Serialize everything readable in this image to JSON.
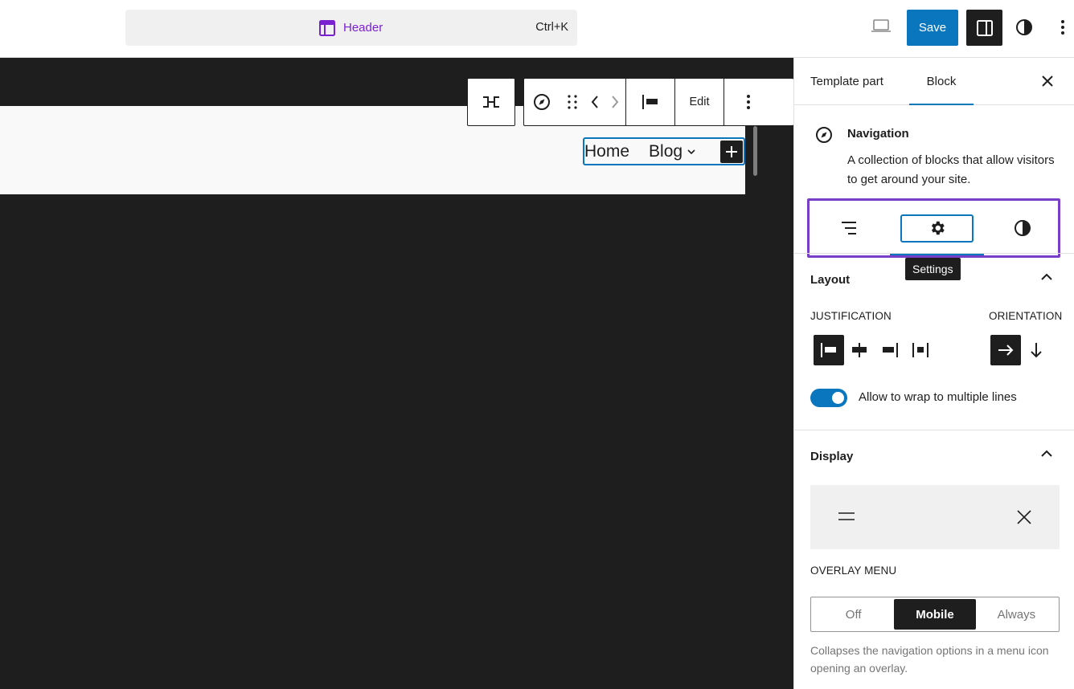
{
  "header": {
    "command_title": "Header",
    "command_shortcut": "Ctrl+K",
    "save_label": "Save",
    "accent_color": "#0a76bd",
    "template_color": "#7b1fd3"
  },
  "canvas": {
    "nav_items": [
      "Home",
      "Blog"
    ],
    "toolbar_edit_label": "Edit"
  },
  "sidebar": {
    "tabs": [
      "Template part",
      "Block"
    ],
    "block": {
      "title": "Navigation",
      "description": "A collection of blocks that allow visitors to get around your site."
    },
    "tooltip": "Settings",
    "layout": {
      "title": "Layout",
      "justification_label": "JUSTIFICATION",
      "orientation_label": "ORIENTATION",
      "wrap_label": "Allow to wrap to multiple lines",
      "wrap_enabled": true
    },
    "display": {
      "title": "Display",
      "overlay_label": "OVERLAY MENU",
      "overlay_options": [
        "Off",
        "Mobile",
        "Always"
      ],
      "overlay_selected": "Mobile",
      "help": "Collapses the navigation options in a menu icon opening an overlay."
    }
  }
}
